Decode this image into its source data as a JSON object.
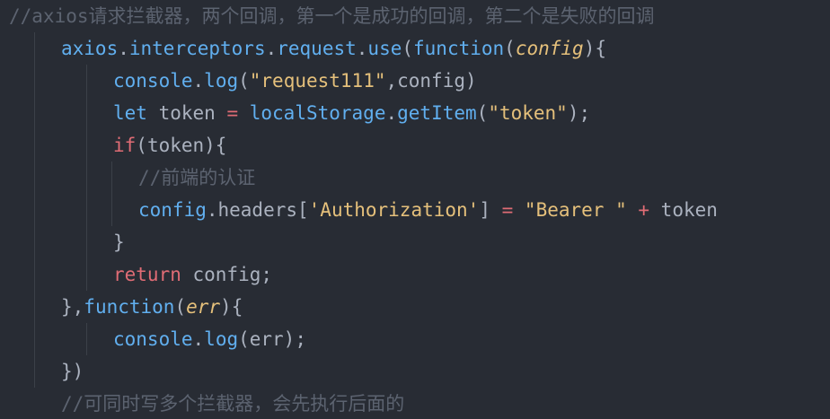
{
  "editor": {
    "lines": [
      {
        "indent": 0,
        "tokens": [
          {
            "t": "//axios请求拦截器，两个回调，第一个是成功的回调，第二个是失败的回调",
            "c": "comment"
          }
        ]
      },
      {
        "indent": 1,
        "tokens": [
          {
            "t": "axios",
            "c": "func"
          },
          {
            "t": ".",
            "c": "punc"
          },
          {
            "t": "interceptors",
            "c": "func"
          },
          {
            "t": ".",
            "c": "punc"
          },
          {
            "t": "request",
            "c": "func"
          },
          {
            "t": ".",
            "c": "punc"
          },
          {
            "t": "use",
            "c": "func"
          },
          {
            "t": "(",
            "c": "punc"
          },
          {
            "t": "function",
            "c": "func"
          },
          {
            "t": "(",
            "c": "punc"
          },
          {
            "t": "config",
            "c": "param"
          },
          {
            "t": "){",
            "c": "punc"
          }
        ]
      },
      {
        "indent": 2,
        "tokens": [
          {
            "t": "console",
            "c": "func"
          },
          {
            "t": ".",
            "c": "punc"
          },
          {
            "t": "log",
            "c": "func"
          },
          {
            "t": "(",
            "c": "punc"
          },
          {
            "t": "\"request111\"",
            "c": "string"
          },
          {
            "t": ",config)",
            "c": "punc"
          }
        ]
      },
      {
        "indent": 2,
        "tokens": [
          {
            "t": "let",
            "c": "func"
          },
          {
            "t": " token ",
            "c": "ident"
          },
          {
            "t": "=",
            "c": "control"
          },
          {
            "t": " localStorage",
            "c": "func"
          },
          {
            "t": ".",
            "c": "punc"
          },
          {
            "t": "getItem",
            "c": "func"
          },
          {
            "t": "(",
            "c": "punc"
          },
          {
            "t": "\"token\"",
            "c": "string"
          },
          {
            "t": ");",
            "c": "punc"
          }
        ]
      },
      {
        "indent": 2,
        "tokens": [
          {
            "t": "if",
            "c": "control"
          },
          {
            "t": "(token){",
            "c": "punc"
          }
        ]
      },
      {
        "indent": 3,
        "tokens": [
          {
            "t": "//前端的认证",
            "c": "comment"
          }
        ]
      },
      {
        "indent": 3,
        "tokens": [
          {
            "t": "config",
            "c": "func"
          },
          {
            "t": ".headers[",
            "c": "punc"
          },
          {
            "t": "'Authorization'",
            "c": "string"
          },
          {
            "t": "] ",
            "c": "punc"
          },
          {
            "t": "=",
            "c": "control"
          },
          {
            "t": " ",
            "c": "punc"
          },
          {
            "t": "\"Bearer \"",
            "c": "string"
          },
          {
            "t": " ",
            "c": "punc"
          },
          {
            "t": "+",
            "c": "control"
          },
          {
            "t": " token",
            "c": "ident"
          }
        ]
      },
      {
        "indent": 2,
        "tokens": [
          {
            "t": "}",
            "c": "punc"
          }
        ]
      },
      {
        "indent": 2,
        "tokens": [
          {
            "t": "return",
            "c": "control"
          },
          {
            "t": " config;",
            "c": "punc"
          }
        ]
      },
      {
        "indent": 1,
        "tokens": [
          {
            "t": "},",
            "c": "punc"
          },
          {
            "t": "function",
            "c": "func"
          },
          {
            "t": "(",
            "c": "punc"
          },
          {
            "t": "err",
            "c": "param"
          },
          {
            "t": "){",
            "c": "punc"
          }
        ]
      },
      {
        "indent": 2,
        "tokens": [
          {
            "t": "console",
            "c": "func"
          },
          {
            "t": ".",
            "c": "punc"
          },
          {
            "t": "log",
            "c": "func"
          },
          {
            "t": "(err);",
            "c": "punc"
          }
        ]
      },
      {
        "indent": 1,
        "tokens": [
          {
            "t": "})",
            "c": "punc"
          }
        ]
      },
      {
        "indent": 1,
        "tokens": [
          {
            "t": "//可同时写多个拦截器，会先执行后面的",
            "c": "comment"
          }
        ]
      }
    ]
  },
  "colors": {
    "background": "#282c34",
    "comment": "#5c6370",
    "function": "#61afef",
    "keyword": "#c678dd",
    "control": "#e06c75",
    "string": "#e5c07b",
    "text": "#abb2bf"
  }
}
